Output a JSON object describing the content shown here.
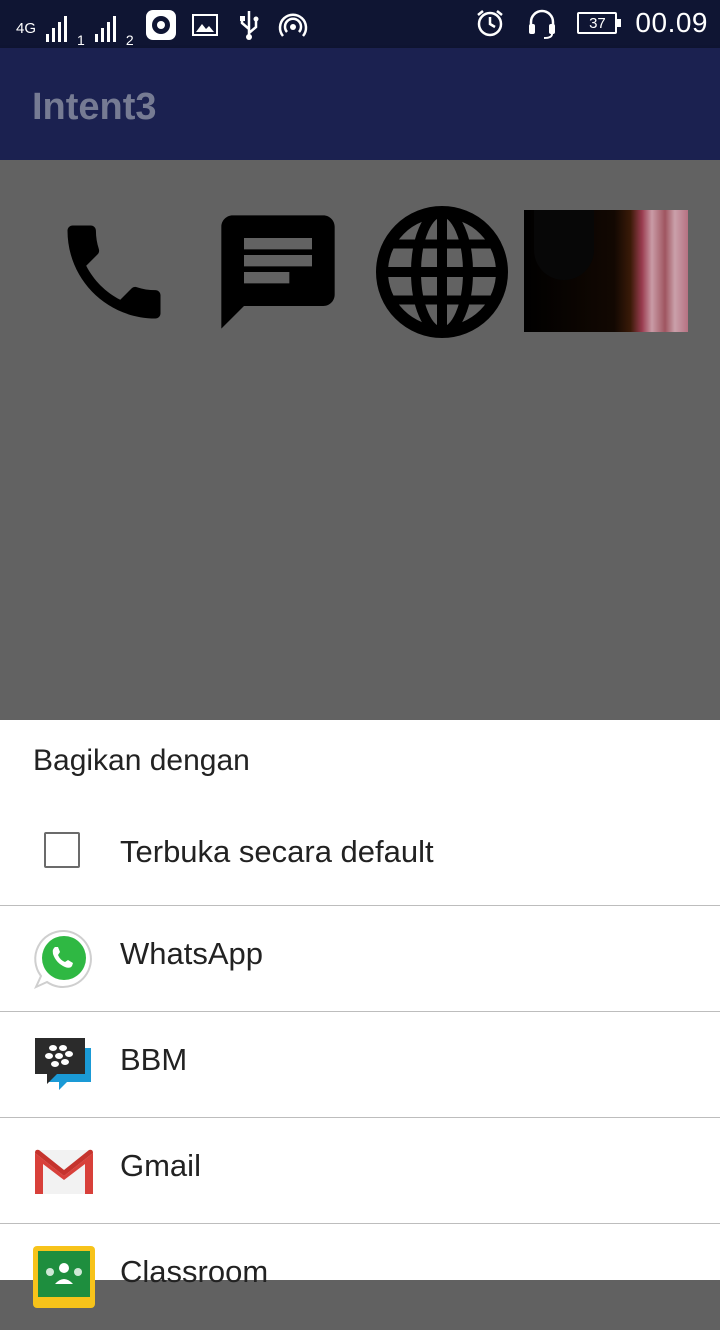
{
  "status_bar": {
    "network_type": "4G",
    "sim1_label": "1",
    "sim2_label": "2",
    "battery_level": "37",
    "time": "00.09",
    "icons": [
      "signal-icon",
      "music-icon",
      "image-icon",
      "usb-icon",
      "hotspot-icon",
      "alarm-icon",
      "headset-icon",
      "battery-icon"
    ]
  },
  "app_bar": {
    "title": "Intent3"
  },
  "main": {
    "icons": [
      "phone-icon",
      "message-icon",
      "globe-icon",
      "photo-thumbnail"
    ]
  },
  "share_sheet": {
    "title": "Bagikan dengan",
    "default_checkbox": {
      "label": "Terbuka secara default",
      "checked": false
    },
    "apps": [
      {
        "label": "WhatsApp",
        "icon": "whatsapp-icon"
      },
      {
        "label": "BBM",
        "icon": "bbm-icon"
      },
      {
        "label": "Gmail",
        "icon": "gmail-icon"
      },
      {
        "label": "Classroom",
        "icon": "classroom-icon"
      }
    ]
  }
}
